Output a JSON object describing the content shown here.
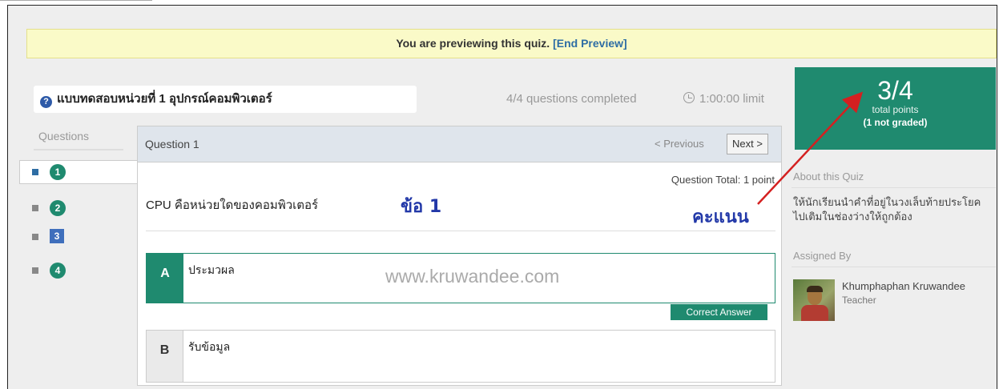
{
  "banner": {
    "text": "You are previewing this quiz.",
    "link": "[End Preview]"
  },
  "quiz": {
    "title": "แบบทดสอบหน่วยที่ 1 อุปกรณ์คอมพิวเตอร์",
    "completed": "4/4 questions completed",
    "limit": "1:00:00 limit"
  },
  "points": {
    "score": "3/4",
    "label": "total points",
    "not_graded": "(1 not graded)"
  },
  "sidebar": {
    "questions_label": "Questions",
    "items": [
      {
        "number": "1",
        "state": "active"
      },
      {
        "number": "2",
        "state": "answered"
      },
      {
        "number": "3",
        "state": "ungraded"
      },
      {
        "number": "4",
        "state": "answered"
      }
    ]
  },
  "question": {
    "header": "Question 1",
    "prev": "< Previous",
    "next": "Next >",
    "total": "Question Total: 1 point",
    "text": "CPU คือหน่วยใดของคอมพิวเตอร์",
    "options": [
      {
        "letter": "A",
        "text": "ประมวผล",
        "correct": true
      },
      {
        "letter": "B",
        "text": "รับข้อมูล",
        "correct": false
      }
    ],
    "correct_label": "Correct Answer"
  },
  "annotations": {
    "question_marker": "ข้อ 1",
    "score_marker": "คะแนน",
    "watermark": "www.kruwandee.com"
  },
  "about": {
    "heading": "About this Quiz",
    "text": "ให้นักเรียนนำคำที่อยู่ในวงเล็บท้ายประโยคไปเติมในช่องว่างให้ถูกต้อง"
  },
  "assigned": {
    "heading": "Assigned By",
    "name": "Khumphaphan Kruwandee",
    "role": "Teacher"
  },
  "colors": {
    "accent": "#1f8a6f",
    "link": "#2e6da4",
    "annotation": "#2238a8",
    "arrow": "#d42020",
    "banner_bg": "#fafac8"
  }
}
